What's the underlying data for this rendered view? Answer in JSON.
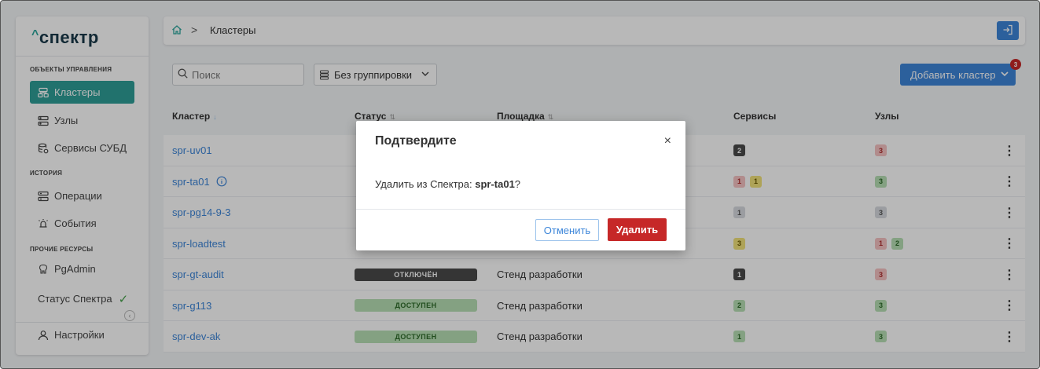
{
  "app": {
    "logo_caret": "^",
    "logo": "спектр"
  },
  "sidebar": {
    "sections": [
      {
        "title": "ОБЪЕКТЫ УПРАВЛЕНИЯ"
      },
      {
        "title": "ИСТОРИЯ"
      },
      {
        "title": "ПРОЧИЕ РЕСУРСЫ"
      }
    ],
    "items": [
      {
        "label": "Кластеры",
        "icon": "cluster-icon",
        "active": true
      },
      {
        "label": "Узлы",
        "icon": "nodes-icon"
      },
      {
        "label": "Сервисы СУБД",
        "icon": "database-icon"
      },
      {
        "label": "Операции",
        "icon": "operations-icon"
      },
      {
        "label": "События",
        "icon": "events-icon"
      },
      {
        "label": "PgAdmin",
        "icon": "pgadmin-icon"
      },
      {
        "label": "Статус Спектра",
        "icon": "check-icon"
      },
      {
        "label": "Настройки",
        "icon": "user-icon"
      }
    ]
  },
  "breadcrumb": {
    "current": "Кластеры",
    "separator": ">"
  },
  "toolbar": {
    "search_placeholder": "Поиск",
    "grouping": "Без группировки",
    "add_cluster": "Добавить кластер",
    "notification_count": "3"
  },
  "table": {
    "columns": [
      "Кластер",
      "Статус",
      "Площадка",
      "Сервисы",
      "Узлы"
    ],
    "rows": [
      {
        "cluster": "spr-uv01",
        "status": "",
        "site": "",
        "services": [
          {
            "v": "2",
            "c": "dark"
          }
        ],
        "nodes": [
          {
            "v": "3",
            "c": "red"
          }
        ]
      },
      {
        "cluster": "spr-ta01",
        "status": "",
        "site": "",
        "services": [
          {
            "v": "1",
            "c": "red"
          },
          {
            "v": "1",
            "c": "yellow"
          }
        ],
        "nodes": [
          {
            "v": "3",
            "c": "green"
          }
        ]
      },
      {
        "cluster": "spr-pg14-9-3",
        "status": "",
        "site": "",
        "services": [
          {
            "v": "1",
            "c": "gray"
          }
        ],
        "nodes": [
          {
            "v": "3",
            "c": "gray"
          }
        ]
      },
      {
        "cluster": "spr-loadtest",
        "status": "",
        "site": "",
        "services": [
          {
            "v": "3",
            "c": "yellow"
          }
        ],
        "nodes": [
          {
            "v": "1",
            "c": "red"
          },
          {
            "v": "2",
            "c": "green"
          }
        ]
      },
      {
        "cluster": "spr-gt-audit",
        "status": "ОТКЛЮЧЁН",
        "status_kind": "off",
        "site": "Стенд разработки",
        "services": [
          {
            "v": "1",
            "c": "dark"
          }
        ],
        "nodes": [
          {
            "v": "3",
            "c": "red"
          }
        ]
      },
      {
        "cluster": "spr-g113",
        "status": "ДОСТУПЕН",
        "status_kind": "ok",
        "site": "Стенд разработки",
        "services": [
          {
            "v": "2",
            "c": "green"
          }
        ],
        "nodes": [
          {
            "v": "3",
            "c": "green"
          }
        ]
      },
      {
        "cluster": "spr-dev-ak",
        "status": "ДОСТУПЕН",
        "status_kind": "ok",
        "site": "Стенд разработки",
        "services": [
          {
            "v": "1",
            "c": "green"
          }
        ],
        "nodes": [
          {
            "v": "3",
            "c": "green"
          }
        ]
      }
    ]
  },
  "modal": {
    "title": "Подтвердите",
    "close": "×",
    "message_prefix": "Удалить из Спектра: ",
    "target": "spr-ta01",
    "message_suffix": "?",
    "cancel": "Отменить",
    "confirm": "Удалить"
  },
  "colors": {
    "accent": "#2f9e98",
    "primary": "#3d86d9",
    "danger": "#c62828"
  }
}
